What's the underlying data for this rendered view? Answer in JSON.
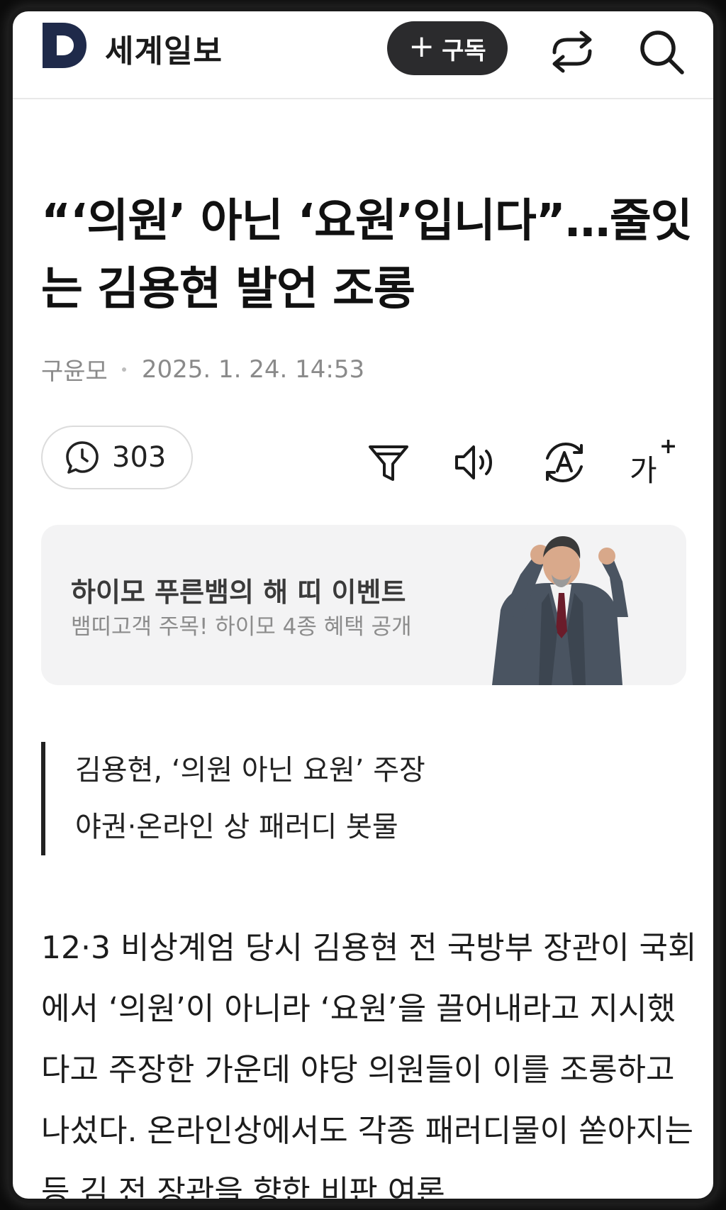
{
  "header": {
    "logo_letter": "D",
    "brand_name": "세계일보",
    "subscribe_plus": "+",
    "subscribe_label": "구독",
    "icons": [
      "share-icon",
      "search-icon"
    ]
  },
  "article": {
    "title": "“‘의원’ 아닌 ‘요원’입니다”…줄잇는 김용현 발언 조롱",
    "author": "구윤모",
    "date": "2025. 1. 24. 14:53",
    "comment_count": "303",
    "tools": [
      "summary-icon",
      "listen-icon",
      "translate-icon",
      "font-size-icon"
    ],
    "font_tool_label": "가",
    "font_tool_plus": "+"
  },
  "ad": {
    "title": "하이모 푸른뱀의 해 띠 이벤트",
    "subtitle": "뱀띠고객 주목! 하이모 4종 혜택 공개"
  },
  "summary": {
    "lines": [
      "김용현, ‘의원 아닌 요원’ 주장",
      "야권·온라인 상 패러디 봇물"
    ]
  },
  "body": {
    "text": "12·3 비상계엄 당시 김용현 전 국방부 장관이 국회에서 ‘의원’이 아니라 ‘요원’을 끌어내라고 지시했다고 주장한 가운데 야당 의원들이 이를 조롱하고 나섰다. 온라인상에서도 각종 패러디물이 쏟아지는 등 김 전 장관을 향한 비판 여론"
  },
  "colors": {
    "logo_navy": "#1f2a4a",
    "button_dark": "#2b2b2d",
    "ad_bg": "#f3f3f4"
  }
}
